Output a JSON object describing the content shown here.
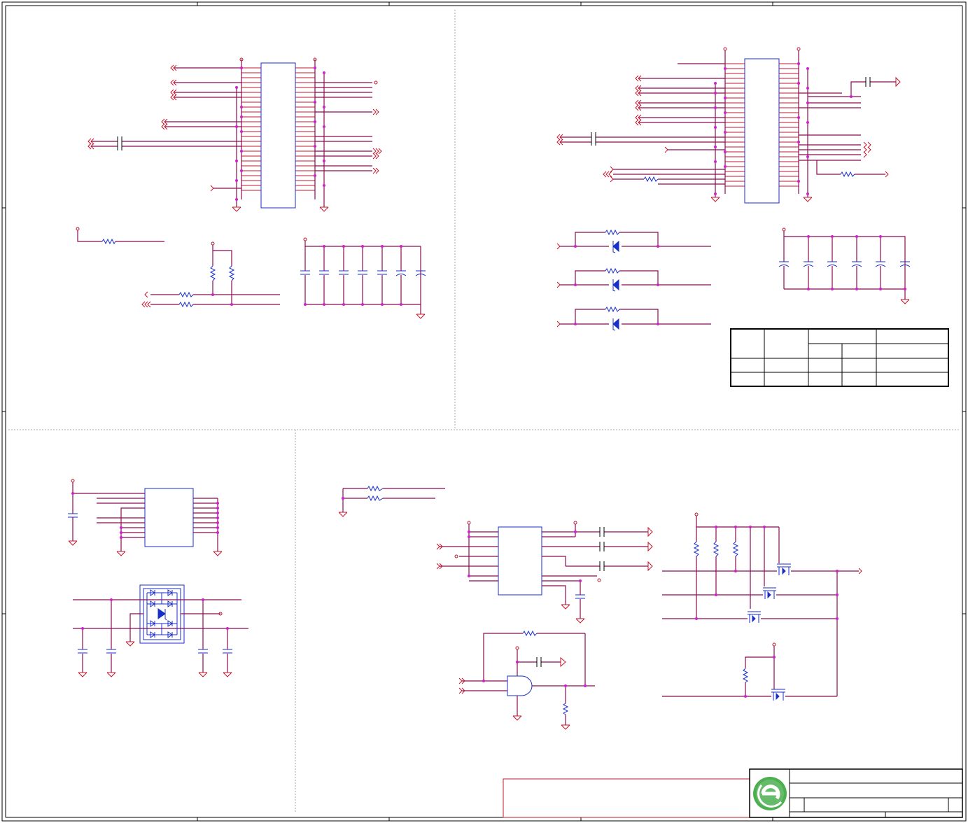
{
  "sheet": {
    "title": "",
    "border_color": "#000000"
  },
  "colors": {
    "wire": "#8b0a50",
    "pin": "#c0172b",
    "component": "#1a2ec8",
    "junction": "#d020d0",
    "logo_green": "#4caf50"
  },
  "blocks": [
    {
      "id": "connector-left",
      "kind": "connector"
    },
    {
      "id": "connector-right",
      "kind": "connector"
    },
    {
      "id": "decoupling-left",
      "kind": "capacitor-bank"
    },
    {
      "id": "decoupling-right",
      "kind": "capacitor-bank"
    },
    {
      "id": "diode-array",
      "kind": "esd-protection"
    },
    {
      "id": "small-ic",
      "kind": "ic"
    },
    {
      "id": "buffer-ic",
      "kind": "ic"
    },
    {
      "id": "and-gate",
      "kind": "logic-gate"
    },
    {
      "id": "mosfet-switches",
      "kind": "power-switch"
    }
  ],
  "logo": {
    "icon": "company-logo-icon"
  },
  "title_block": {
    "rows": 3
  }
}
